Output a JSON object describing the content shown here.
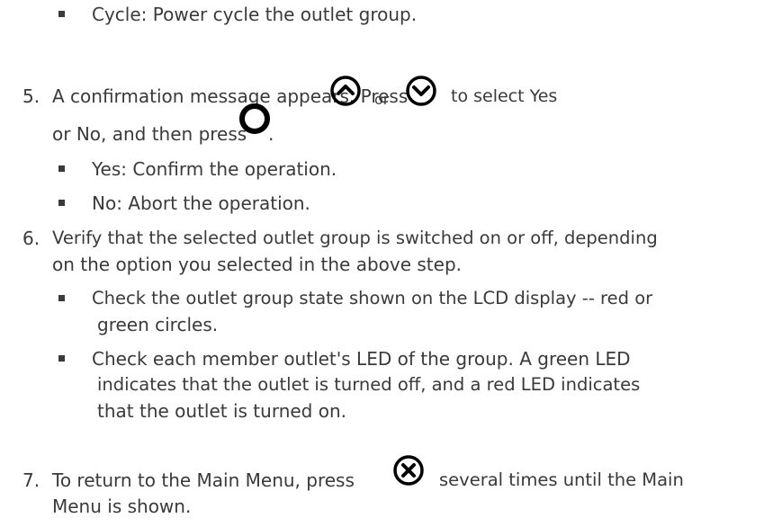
{
  "doc": {
    "bullet_cycle": "Cycle: Power cycle the outlet group.",
    "step5": {
      "number": "5.",
      "text_a": "A confirmation message appears. Press",
      "text_or": "or",
      "text_b": "to select Yes",
      "line2_a": "or No, and then press",
      "line2_b": ".",
      "bullets": [
        "Yes: Confirm the operation.",
        "No: Abort the operation."
      ],
      "icons": [
        "up-arrow-icon",
        "down-arrow-icon",
        "ok-button-icon"
      ]
    },
    "step6": {
      "number": "6.",
      "line1": "Verify that the selected outlet group is switched on or off, depending",
      "line2": "on the option you selected in the above step.",
      "bullet1_line1": "Check the outlet group state shown on the LCD display -- red or",
      "bullet1_line2": "green circles.",
      "bullet2_line1": "Check each member outlet's LED of the group. A green LED",
      "bullet2_line2": "indicates that the outlet is turned off, and a red LED indicates",
      "bullet2_line3": "that the outlet is turned on."
    },
    "step7": {
      "number": "7.",
      "text_a": "To return to the Main Menu, press",
      "text_b": "several times until the Main",
      "line2": "Menu is shown.",
      "icons": [
        "close-x-icon"
      ]
    }
  }
}
